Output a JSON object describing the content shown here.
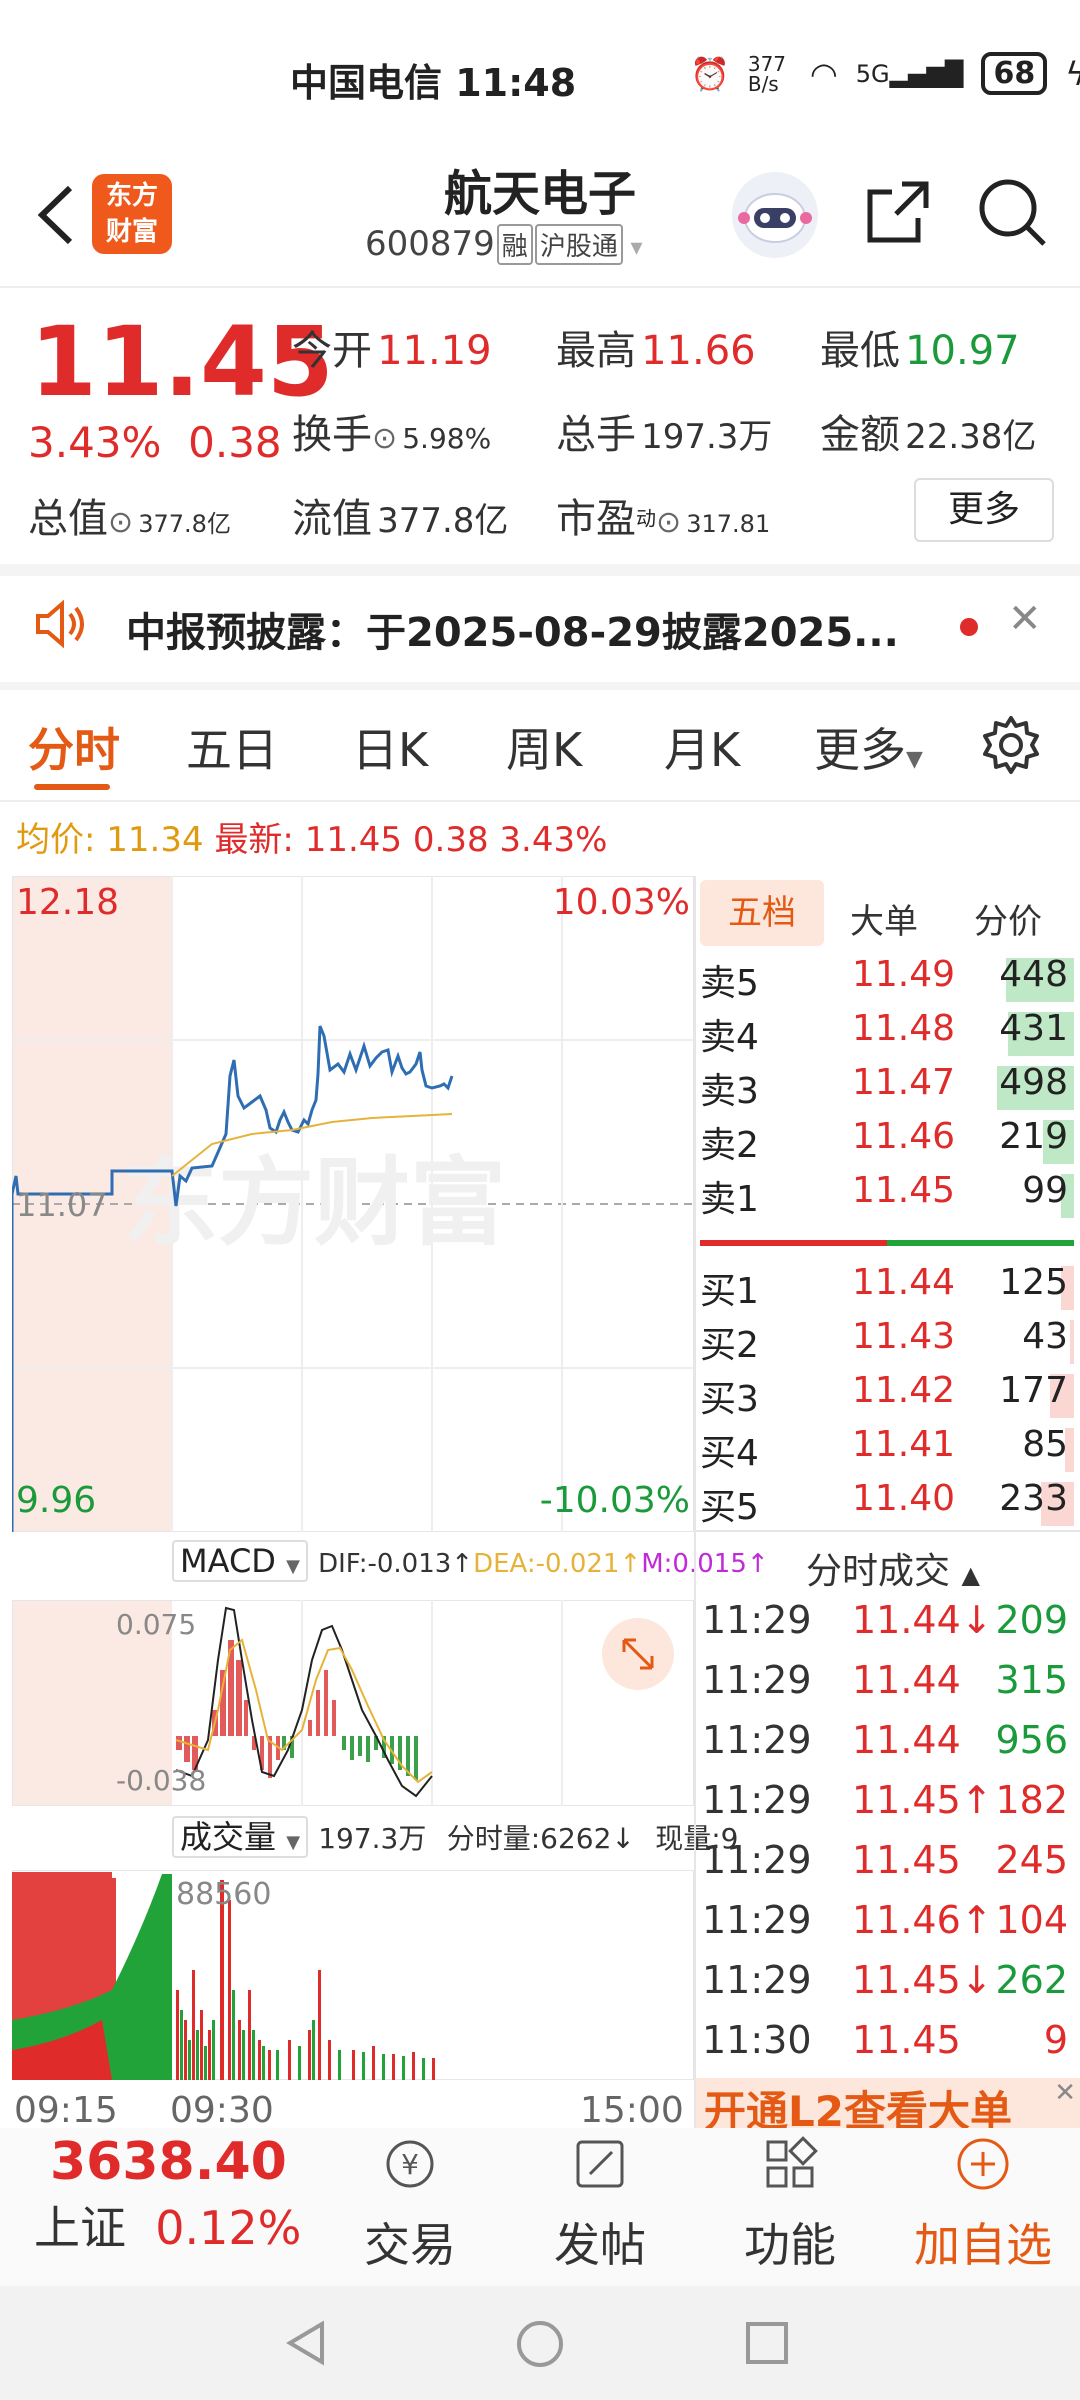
{
  "status_bar": {
    "carrier_time": "中国电信 11:48",
    "net_speed": "377 B/s",
    "signal": "5G",
    "battery": "68"
  },
  "header": {
    "title": "航天电子",
    "code": "600879",
    "tag_margin": "融",
    "tag_market": "沪股通",
    "logo_text_1": "东方",
    "logo_text_2": "财富"
  },
  "quote": {
    "price": "11.45",
    "change_pct": "3.43%",
    "change": "0.38",
    "open_label": "今开",
    "open": "11.19",
    "high_label": "最高",
    "high": "11.66",
    "low_label": "最低",
    "low": "10.97",
    "turnover_label": "换手",
    "turnover": "5.98%",
    "volume_label": "总手",
    "volume": "197.3万",
    "amount_label": "金额",
    "amount": "22.38亿",
    "mktcap_label": "总值",
    "mktcap": "377.8亿",
    "float_label": "流值",
    "float": "377.8亿",
    "pe_label": "市盈",
    "pe_sup": "动",
    "pe": "317.81",
    "more_label": "更多"
  },
  "notice": {
    "text": "中报预披露：于2025-08-29披露2025..."
  },
  "tabs": [
    "分时",
    "五日",
    "日K",
    "周K",
    "月K",
    "更多"
  ],
  "price_info": {
    "avg_label": "均价:",
    "avg": "11.34",
    "last_label": "最新:",
    "last": "11.45",
    "chg": "0.38",
    "pct": "3.43%"
  },
  "chart": {
    "top_price": "12.18",
    "top_pct": "10.03%",
    "mid_price": "11.07",
    "bottom_price": "9.96",
    "bottom_pct": "-10.03%",
    "watermark": "东方财富",
    "macd_label": "MACD",
    "dif": "DIF:-0.013↑",
    "dea": "DEA:-0.021↑",
    "m": "M:0.015↑",
    "macd_top": "0.075",
    "macd_bottom": "-0.038",
    "vol_label": "成交量",
    "vol_total": "197.3万",
    "vol_min": "分时量:6262↓",
    "vol_now": "现量:9",
    "vol_max": "88560",
    "time_start": "09:15",
    "time_mid": "09:30",
    "time_end": "15:00"
  },
  "orderbook": {
    "tabs": [
      "五档",
      "大单",
      "分价"
    ],
    "asks": [
      {
        "label": "卖5",
        "price": "11.49",
        "vol": "448",
        "bar": 0.62
      },
      {
        "label": "卖4",
        "price": "11.48",
        "vol": "431",
        "bar": 0.6
      },
      {
        "label": "卖3",
        "price": "11.47",
        "vol": "498",
        "bar": 0.7
      },
      {
        "label": "卖2",
        "price": "11.46",
        "vol": "219",
        "bar": 0.28
      },
      {
        "label": "卖1",
        "price": "11.45",
        "vol": "99",
        "bar": 0.12
      }
    ],
    "bids": [
      {
        "label": "买1",
        "price": "11.44",
        "vol": "125",
        "bar": 0.12
      },
      {
        "label": "买2",
        "price": "11.43",
        "vol": "43",
        "bar": 0.04
      },
      {
        "label": "买3",
        "price": "11.42",
        "vol": "177",
        "bar": 0.22
      },
      {
        "label": "买4",
        "price": "11.41",
        "vol": "85",
        "bar": 0.08
      },
      {
        "label": "买5",
        "price": "11.40",
        "vol": "233",
        "bar": 0.3
      }
    ]
  },
  "trades": {
    "title": "分时成交",
    "rows": [
      {
        "time": "11:29",
        "price": "11.44↓",
        "vol": "209",
        "color": "#1a9a3a"
      },
      {
        "time": "11:29",
        "price": "11.44",
        "vol": "315",
        "color": "#1a9a3a"
      },
      {
        "time": "11:29",
        "price": "11.44",
        "vol": "956",
        "color": "#1a9a3a"
      },
      {
        "time": "11:29",
        "price": "11.45↑",
        "vol": "182",
        "color": "#e02b2b"
      },
      {
        "time": "11:29",
        "price": "11.45",
        "vol": "245",
        "color": "#e02b2b"
      },
      {
        "time": "11:29",
        "price": "11.46↑",
        "vol": "104",
        "color": "#e02b2b"
      },
      {
        "time": "11:29",
        "price": "11.45↓",
        "vol": "262",
        "color": "#1a9a3a"
      },
      {
        "time": "11:30",
        "price": "11.45",
        "vol": "9",
        "color": "#e02b2b"
      }
    ],
    "l2_banner": "开通L2查看大单"
  },
  "bottom_nav": {
    "index_value": "3638.40",
    "index_name": "上证",
    "index_pct": "0.12%",
    "items": [
      "交易",
      "发帖",
      "功能",
      "加自选"
    ]
  }
}
